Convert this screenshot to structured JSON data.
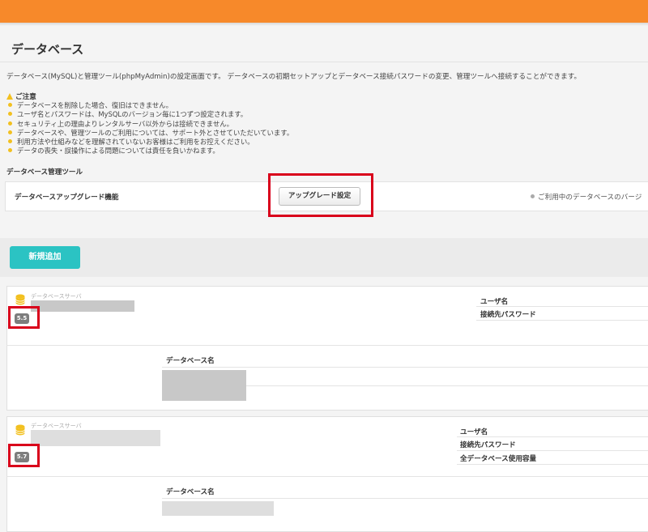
{
  "page": {
    "title": "データベース",
    "description": "データベース(MySQL)と管理ツール(phpMyAdmin)の設定画面です。 データベースの初期セットアップとデータベース接続パスワードの変更、管理ツールへ接続することができます。"
  },
  "notice": {
    "heading": "ご注意",
    "items": [
      "データベースを削除した場合、復旧はできません。",
      "ユーザ名とパスワードは、MySQLのバージョン毎に1つずつ設定されます。",
      "セキュリティ上の理由よりレンタルサーバ以外からは接続できません。",
      "データベースや、管理ツールのご利用については、サポート外とさせていただいています。",
      "利用方法や仕組みなどを理解されていないお客様はご利用をお控えください。",
      "データの喪失・誤操作による問題については責任を負いかねます。"
    ]
  },
  "tools": {
    "heading": "データベース管理ツール",
    "upgrade_label": "データベースアップグレード機能",
    "upgrade_button": "アップグレード設定",
    "note": "ご利用中のデータベースのバージ"
  },
  "actions": {
    "add_button": "新規追加"
  },
  "servers": [
    {
      "server_label": "データベースサーバ",
      "version": "5.5",
      "user_label": "ユーザ名",
      "password_label": "接続先パスワード",
      "db_name_label": "データベース名"
    },
    {
      "server_label": "データベースサーバ",
      "version": "5.7",
      "user_label": "ユーザ名",
      "password_label": "接続先パスワード",
      "usage_label": "全データベース使用容量",
      "db_name_label": "データベース名"
    }
  ],
  "colors": {
    "header": "#f7892a",
    "accent": "#2bc3c3",
    "highlight": "#d9001b",
    "warning": "#f2c01f"
  }
}
